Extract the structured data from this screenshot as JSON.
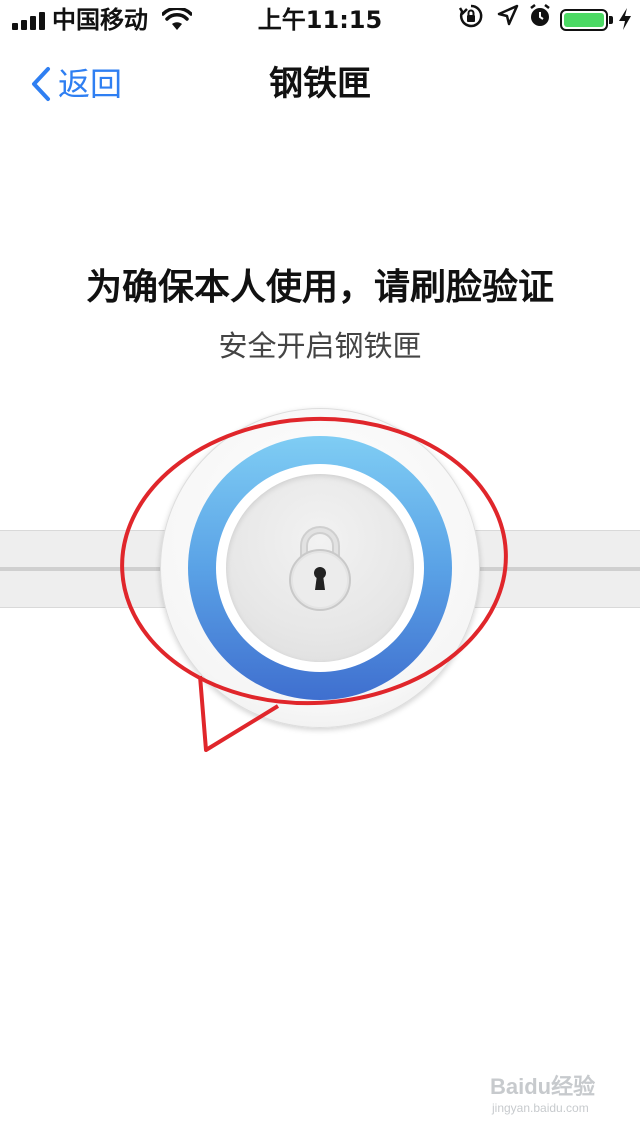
{
  "status_bar": {
    "carrier": "中国移动",
    "time": "上午11:15",
    "battery_level": 1.0,
    "icons": [
      "signal-icon",
      "wifi-icon",
      "orientation-lock-icon",
      "location-icon",
      "alarm-icon",
      "battery-icon",
      "charging-icon"
    ]
  },
  "nav": {
    "back_label": "返回",
    "title": "钢铁匣"
  },
  "prompt": {
    "title": "为确保本人使用，请刷脸验证",
    "subtitle": "安全开启钢铁匣"
  },
  "lock": {
    "icon": "padlock-icon"
  },
  "watermark": {
    "brand": "Baidu经验",
    "url": "jingyan.baidu.com"
  },
  "colors": {
    "accent": "#2f7ff2",
    "ring_top": "#7fcdf4",
    "ring_bottom": "#3f6fcf",
    "annotation": "#e0262b",
    "battery": "#4cd964"
  }
}
